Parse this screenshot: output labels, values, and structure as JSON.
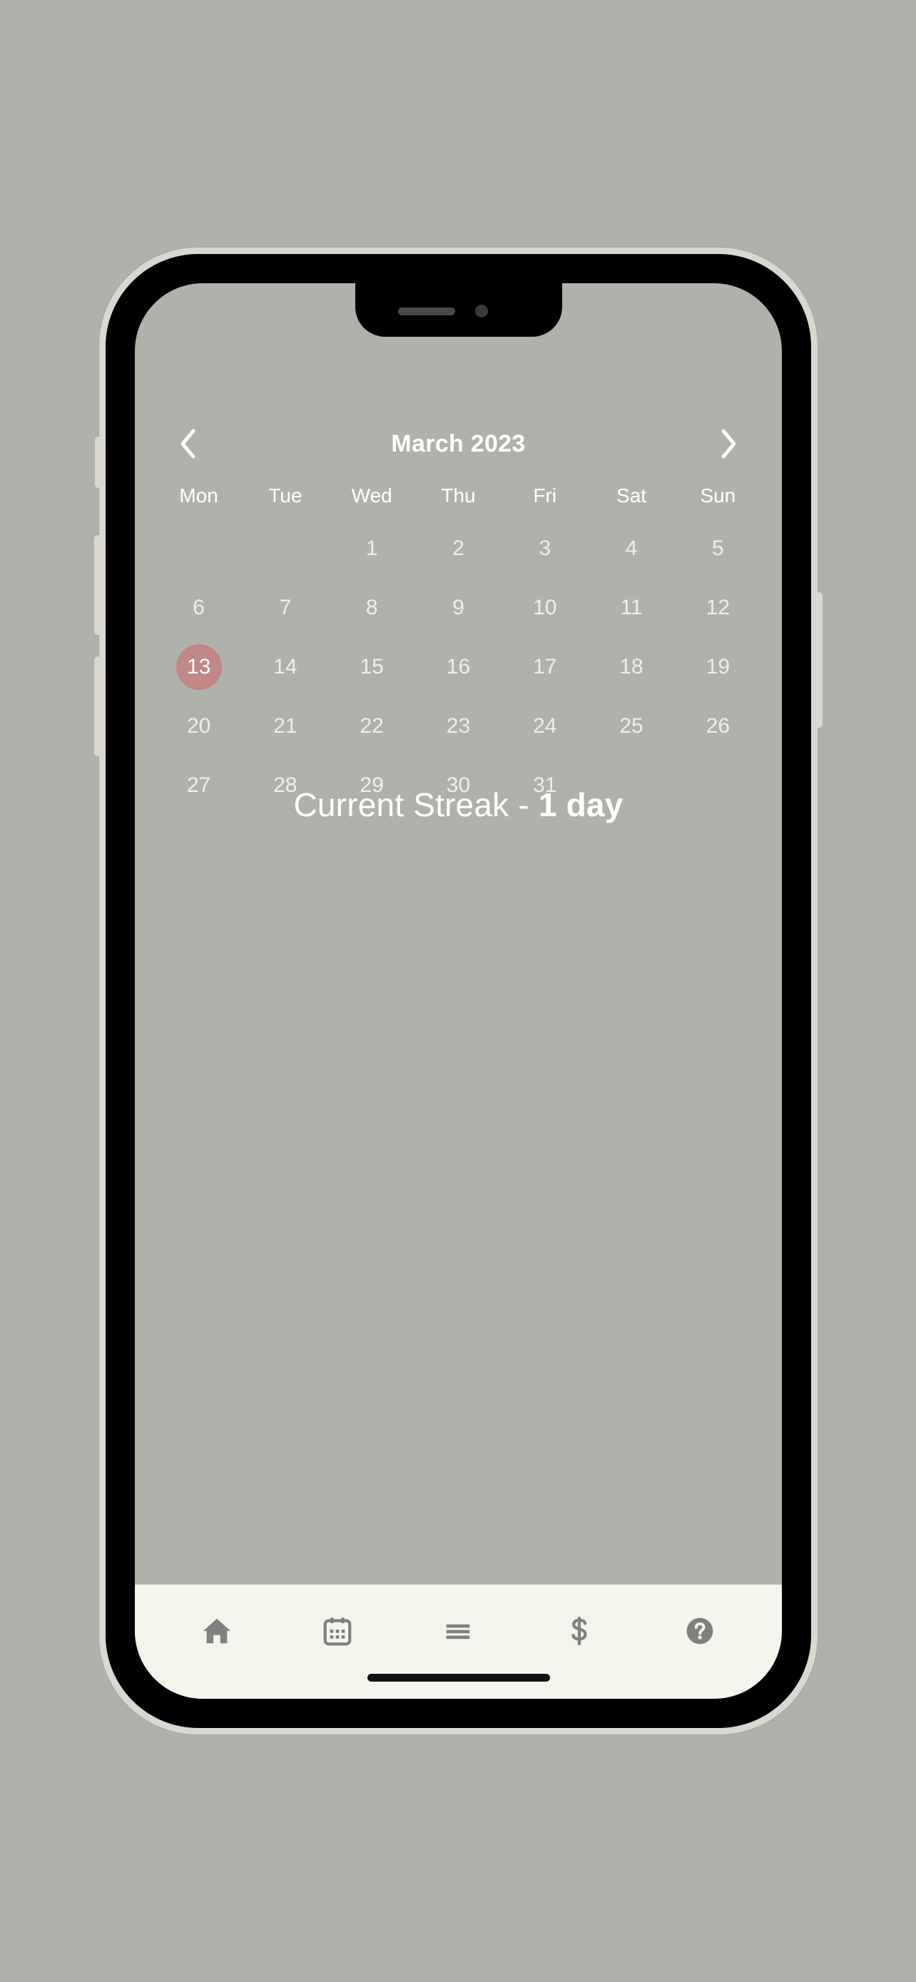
{
  "device": {
    "frame_color": "#d9d7cf",
    "body_color": "#000000",
    "screen_bg": "#aeb2aa"
  },
  "app": {
    "background_color": "#aeb2aa",
    "accent_color": "#c18686",
    "text_color": "#ffffff"
  },
  "calendar": {
    "prev_label": "‹",
    "next_label": "›",
    "title": "March 2023",
    "weekdays": [
      "Mon",
      "Tue",
      "Wed",
      "Thu",
      "Fri",
      "Sat",
      "Sun"
    ],
    "leading_blanks": 2,
    "days": [
      "1",
      "2",
      "3",
      "4",
      "5",
      "6",
      "7",
      "8",
      "9",
      "10",
      "11",
      "12",
      "13",
      "14",
      "15",
      "16",
      "17",
      "18",
      "19",
      "20",
      "21",
      "22",
      "23",
      "24",
      "25",
      "26",
      "27",
      "28",
      "29",
      "30",
      "31"
    ],
    "selected_day": "13",
    "selected_day_bg": "#c18686"
  },
  "streak": {
    "label": "Current Streak - ",
    "value": "1 day"
  },
  "bottom_nav": {
    "background_color": "#f5f4ec",
    "icon_color": "#808080",
    "items": [
      {
        "name": "home-icon",
        "label": "Home"
      },
      {
        "name": "calendar-icon",
        "label": "Calendar"
      },
      {
        "name": "menu-icon",
        "label": "Menu"
      },
      {
        "name": "dollar-icon",
        "label": "Finance"
      },
      {
        "name": "help-icon",
        "label": "Help"
      }
    ]
  }
}
